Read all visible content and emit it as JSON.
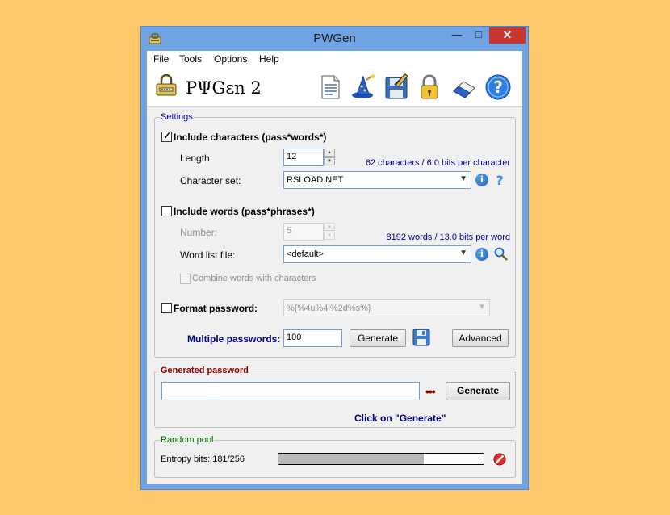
{
  "window": {
    "title": "PWGen",
    "minimize": "—",
    "maximize": "□",
    "close": "✕"
  },
  "menu": [
    "File",
    "Tools",
    "Options",
    "Help"
  ],
  "toolbar": {
    "logo": "PΨGεn 2",
    "icons": [
      "notepad-icon",
      "wizard-icon",
      "save-icon",
      "lock-icon",
      "eraser-icon",
      "help-icon"
    ]
  },
  "settings": {
    "legend": "Settings",
    "include_chars": {
      "label": "Include characters (pass*words*)",
      "checked": true
    },
    "length": {
      "label": "Length:",
      "value": "12"
    },
    "char_info": "62 characters / 6.0 bits per character",
    "charset": {
      "label": "Character set:",
      "value": "RSLOAD.NET"
    },
    "include_words": {
      "label": "Include words (pass*phrases*)",
      "checked": false
    },
    "number": {
      "label": "Number:",
      "value": "5"
    },
    "word_info": "8192 words / 13.0 bits per word",
    "wordlist": {
      "label": "Word list file:",
      "value": "<default>"
    },
    "combine": {
      "label": "Combine words with characters",
      "checked": false
    },
    "format": {
      "label": "Format password:",
      "value": "%{%4u%4l%2d%s%}",
      "checked": false
    },
    "multiple": {
      "label": "Multiple passwords:",
      "value": "100"
    },
    "generate_label": "Generate",
    "advanced_label": "Advanced"
  },
  "generated": {
    "legend": "Generated password",
    "value": "",
    "dots": "•••",
    "generate_label": "Generate",
    "hint": "Click on \"Generate\""
  },
  "pool": {
    "legend": "Random pool",
    "entropy": "Entropy bits: 181/256",
    "fill_fraction": 0.707
  },
  "colors": {
    "accent": "#00008B",
    "legend_red": "#8B0000",
    "legend_green": "#006400",
    "close_red": "#C7372F"
  }
}
